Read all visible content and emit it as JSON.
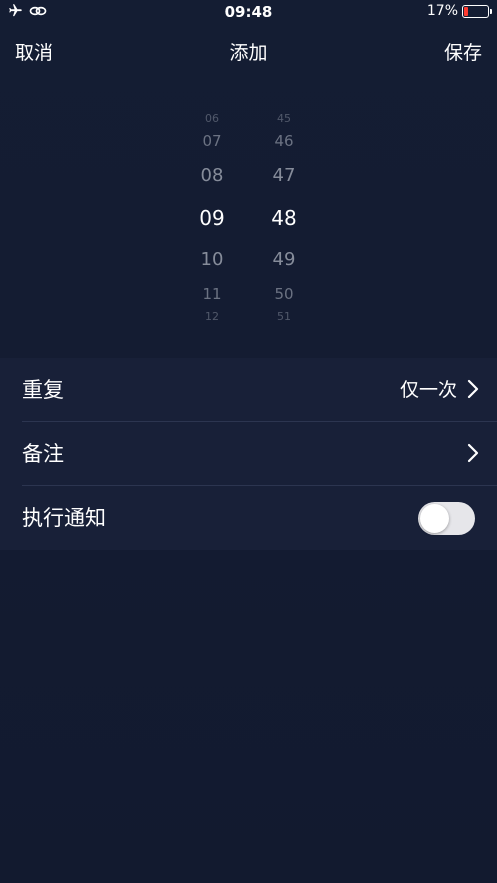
{
  "status_bar": {
    "time": "09:48",
    "battery_text": "17%",
    "battery_level": 0.17,
    "icons": [
      "airplane-icon",
      "link-icon"
    ]
  },
  "nav": {
    "cancel": "取消",
    "title": "添加",
    "save": "保存"
  },
  "picker": {
    "hours": [
      "06",
      "07",
      "08",
      "09",
      "10",
      "11",
      "12"
    ],
    "minutes": [
      "45",
      "46",
      "47",
      "48",
      "49",
      "50",
      "51"
    ],
    "selected_hour": "09",
    "selected_minute": "48"
  },
  "settings": {
    "repeat": {
      "label": "重复",
      "value": "仅一次"
    },
    "note": {
      "label": "备注"
    },
    "notify": {
      "label": "执行通知",
      "enabled": false
    }
  },
  "colors": {
    "background": "#121a2e",
    "list_background": "#182038",
    "battery_low": "#ff3b30"
  }
}
